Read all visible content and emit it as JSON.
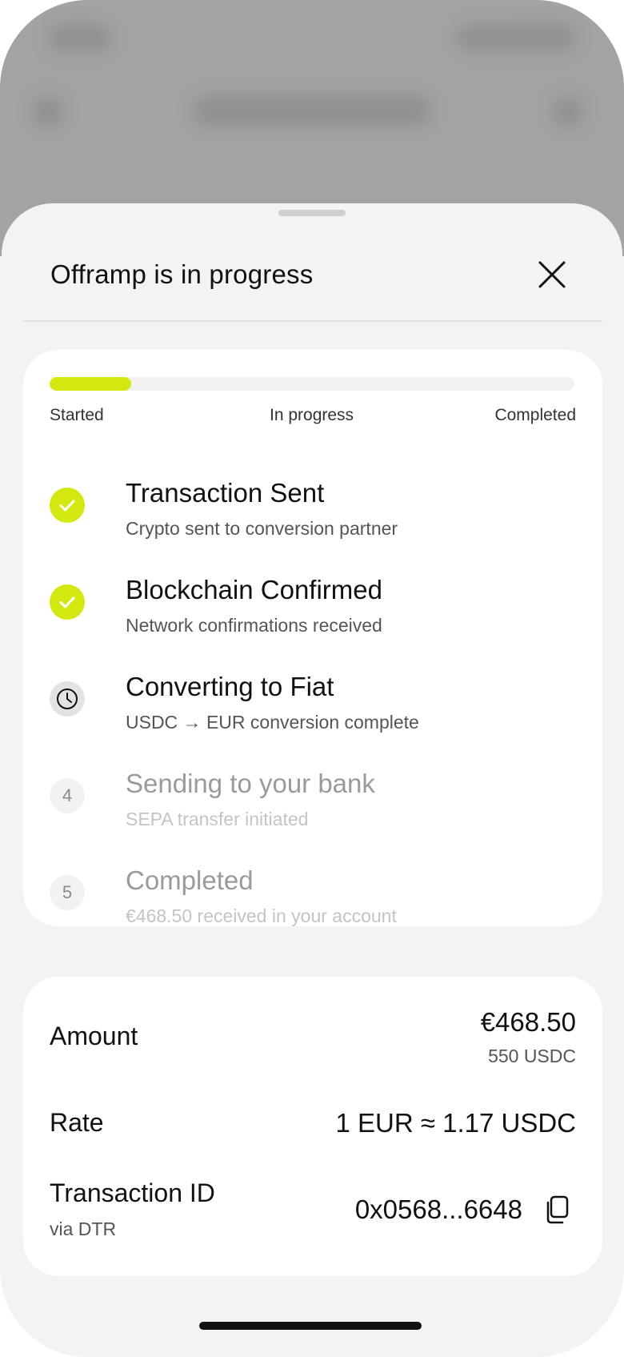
{
  "sheet": {
    "title": "Offramp is in progress",
    "close_icon": "close-icon"
  },
  "progress": {
    "value": 0.155,
    "color": "#d3e80f",
    "stages": [
      "Started",
      "In progress",
      "Completed"
    ]
  },
  "steps": [
    {
      "status": "done",
      "icon": "check-icon",
      "title": "Transaction Sent",
      "subtitle": "Crypto sent to conversion partner"
    },
    {
      "status": "done",
      "icon": "check-icon",
      "title": "Blockchain Confirmed",
      "subtitle": "Network confirmations received"
    },
    {
      "status": "active",
      "icon": "clock-icon",
      "title": "Converting to Fiat",
      "subtitle": "USDC → EUR conversion complete"
    },
    {
      "status": "pending",
      "number": "4",
      "title": "Sending to your bank",
      "subtitle": "SEPA transfer initiated"
    },
    {
      "status": "pending",
      "number": "5",
      "title": "Completed",
      "subtitle": "€468.50 received in your account"
    }
  ],
  "details": {
    "amount": {
      "label": "Amount",
      "value": "€468.50",
      "subvalue": "550 USDC"
    },
    "rate": {
      "label": "Rate",
      "value": "1 EUR ≈ 1.17 USDC"
    },
    "transaction": {
      "label": "Transaction ID",
      "sublabel": "via DTR",
      "value": "0x0568...6648",
      "copy_icon": "copy-icon"
    }
  },
  "colors": {
    "accent": "#d3e80f",
    "sheet_background": "#f3f3f2",
    "card_background": "#ffffff"
  }
}
